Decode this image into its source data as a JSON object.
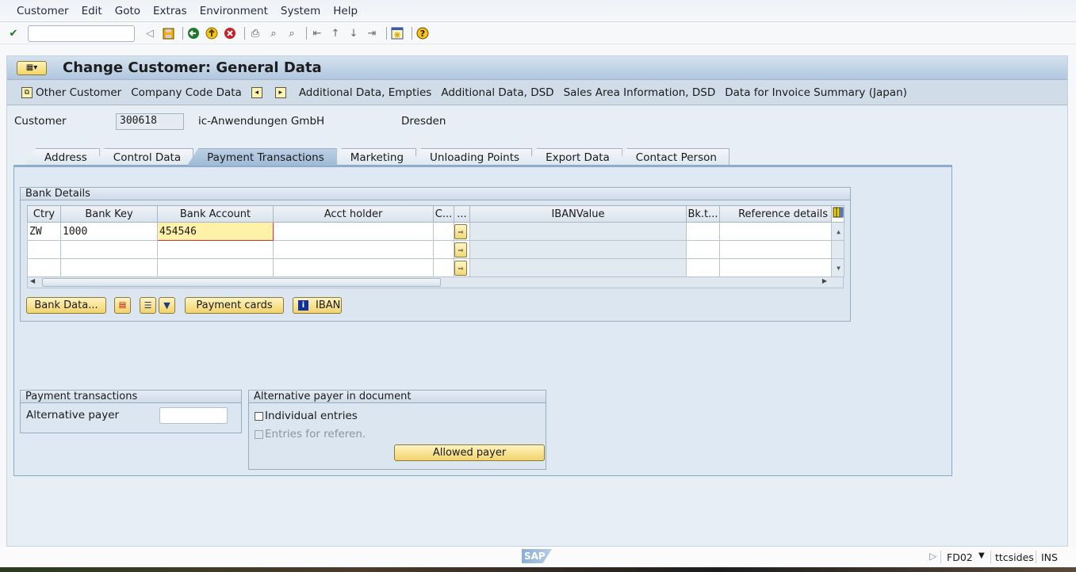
{
  "menu": [
    "Customer",
    "Edit",
    "Goto",
    "Extras",
    "Environment",
    "System",
    "Help"
  ],
  "toolbar": {
    "command_field": "",
    "icons": [
      "enter-icon",
      "back-arrow-icon",
      "save-icon",
      "back-icon",
      "exit-icon",
      "cancel-icon",
      "print-icon",
      "find-icon",
      "find-next-icon",
      "first-page-icon",
      "previous-page-icon",
      "next-page-icon",
      "last-page-icon",
      "layout-icon",
      "help-icon"
    ]
  },
  "window": {
    "title": "Change Customer: General Data"
  },
  "appbar": {
    "items": [
      "Other Customer",
      "Company Code Data",
      "Additional Data, Empties",
      "Additional Data, DSD",
      "Sales Area Information, DSD",
      "Data for Invoice Summary (Japan)"
    ]
  },
  "customer": {
    "label": "Customer",
    "number": "300618",
    "name": "ic-Anwendungen GmbH",
    "city": "Dresden"
  },
  "tabs": [
    {
      "label": "Address",
      "active": false
    },
    {
      "label": "Control Data",
      "active": false
    },
    {
      "label": "Payment Transactions",
      "active": true
    },
    {
      "label": "Marketing",
      "active": false
    },
    {
      "label": "Unloading Points",
      "active": false
    },
    {
      "label": "Export Data",
      "active": false
    },
    {
      "label": "Contact Person",
      "active": false
    }
  ],
  "bank_details": {
    "title": "Bank Details",
    "columns": [
      "Ctry",
      "Bank Key",
      "Bank Account",
      "Acct holder",
      "C...",
      "...",
      "IBANValue",
      "Bk.t...",
      "Reference details"
    ],
    "rows": [
      {
        "ctry": "ZW",
        "bank_key": "1000",
        "bank_account": "454546",
        "acct_holder": "",
        "c": "",
        "iban": "",
        "bkt": "",
        "ref": ""
      },
      {
        "ctry": "",
        "bank_key": "",
        "bank_account": "",
        "acct_holder": "",
        "c": "",
        "iban": "",
        "bkt": "",
        "ref": ""
      },
      {
        "ctry": "",
        "bank_key": "",
        "bank_account": "",
        "acct_holder": "",
        "c": "",
        "iban": "",
        "bkt": "",
        "ref": ""
      }
    ],
    "buttons": {
      "bank_data": "Bank Data...",
      "payment_cards": "Payment cards",
      "iban": "IBAN"
    }
  },
  "payment_transactions": {
    "title": "Payment transactions",
    "alt_payer_label": "Alternative payer",
    "alt_payer_value": ""
  },
  "alt_payer_doc": {
    "title": "Alternative payer in document",
    "individual_entries": "Individual entries",
    "entries_for_referen": "Entries for referen.",
    "allowed_payer": "Allowed payer"
  },
  "status": {
    "logo": "SAP",
    "transaction": "FD02",
    "server": "ttcsides",
    "mode": "INS"
  }
}
